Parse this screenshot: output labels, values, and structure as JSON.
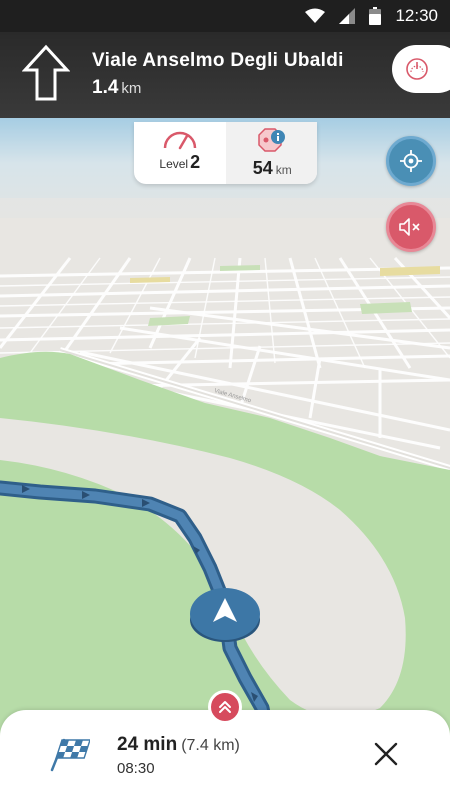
{
  "status_bar": {
    "time": "12:30",
    "icons": [
      "wifi-icon",
      "signal-icon",
      "battery-icon"
    ]
  },
  "navigation": {
    "maneuver_icon": "straight-arrow-icon",
    "street_name": "Viale Anselmo Degli Ubaldi",
    "distance_value": "1.4",
    "distance_unit": "km"
  },
  "info_card": {
    "level_label": "Level",
    "level_value": "2",
    "radar_distance": "54",
    "radar_unit": "km"
  },
  "map": {
    "street_label": "Viale Anselmo"
  },
  "trip": {
    "duration": "24 min",
    "distance": "(7.4 km)",
    "arrival_time": "08:30"
  },
  "colors": {
    "route": "#3d6e98",
    "accent_blue": "#4a8fb5",
    "accent_red": "#d9596a",
    "park_green": "#b5dba5",
    "header_dark": "#2f2f2f"
  }
}
